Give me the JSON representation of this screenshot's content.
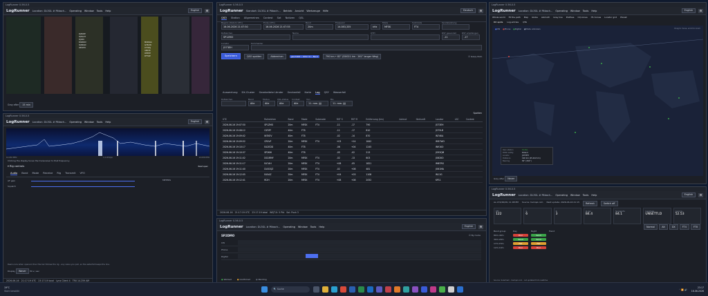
{
  "app": {
    "brand": "LogRunner",
    "title": "LogRunner 0.56.0.5",
    "lang": "English",
    "lang_de": "Deutsch"
  },
  "menus": {
    "operating": "Operating",
    "window": "Window",
    "tools": "Tools",
    "help": "Help"
  },
  "menus_de": {
    "betrieb": "Betrieb",
    "ansicht": "Ansicht",
    "werkzeuge": "Werkzeuge",
    "hilfe": "Hilfe"
  },
  "location_en": "Location: DL3GL # Pöbach...",
  "location_de": "Standort: DL3GL # Pöbach...",
  "bandmap": {
    "title": "LogRunner 0.56.0.5",
    "gray_label": "Gray after",
    "gray_value": "15 min",
    "spots": [
      "DJ3KDE",
      "SV9CVY",
      "DJ1NC",
      "EA8DDV",
      "SQ8GSC",
      "OE1EYC",
      "MI0DGG",
      "G7RUW",
      "CT7PAJ",
      "IU8LTK",
      "OH8YE",
      "DF7GE"
    ]
  },
  "waterfall": {
    "title": "LogRunner 0.56.0.5",
    "hint": "Clicking the display tunes the transceiver to that frequency.",
    "freq_left": "14.032 MHz",
    "freq_center": "1.1 kHz/px",
    "freq_right": "14.036 MHz",
    "rig_section": "Rig controls",
    "rig_right": "Rest spec",
    "rig_tabs": [
      "Audio",
      "Band",
      "Mode",
      "Receive",
      "Rig",
      "Transmit",
      "VFO"
    ],
    "rig_rows": [
      "AF gain",
      "Squelch"
    ],
    "meters_label": "METERS",
    "bottom_hint": "Read-once when opened, then the bar follows the rig - any value you pull, so the waterfall keeps the line.",
    "display_label": "Display",
    "display_value": "Waver",
    "display_extra": "30 s / sec",
    "status": [
      "2026-06-16",
      "21:17:19 UTC",
      "23:17:19 local",
      "Lynx Client 4",
      "TRX 14.259 AM"
    ]
  },
  "qso": {
    "title": "LogRunner 0.56.0.5",
    "tabs": [
      "QSO",
      "Station",
      "Allgemeines",
      "Contest",
      "Sat",
      "Notizen",
      "QSL"
    ],
    "labels": {
      "date": "Beginn (Datum UTC)",
      "end": "Ende (UTC)",
      "band": "Band",
      "freq": "Frequenz",
      "mode": "Mode",
      "submode": "Submode",
      "tx": "Sendeleistung",
      "call": "Rufzeichen",
      "name": "Name",
      "qth": "QTH",
      "rst_s": "RST gesendet",
      "rst_r": "RST empfangen",
      "loc": "Locator",
      "comment": "Kommentar"
    },
    "values": {
      "date": "16.06.2026 21:07:50",
      "end": "16.06.2026 21:07:55",
      "band": "20m",
      "freq": "14.083,335",
      "freq_unit": "kHz",
      "mode": "MFSK",
      "submode": "FT4",
      "call": "SP1ZMO",
      "rst_s": "-11",
      "rst_r": "-17",
      "loc": "JO73EH"
    },
    "buttons": {
      "save": "Speichern",
      "spot": "QSO spotten",
      "clear": "Abbrechen",
      "tag": "geschätzt • 1002 mi • Band",
      "dist": "790 km • 82° (DX021 km · 261° langer Weg)",
      "check": "Gesp./dubl."
    },
    "subtabs": [
      "Auswertung",
      "DX-Cluster",
      "Gearbeitete Länder",
      "Geckanfall",
      "Karte",
      "Log",
      "QSY",
      "Wasserfall"
    ],
    "filters": {
      "call": "Rufzeichen",
      "band": "Band",
      "mode": "Modus",
      "qsl": "QSL-status",
      "contest": "Contest",
      "from": "Von",
      "to": "Bis",
      "all": "Alle",
      "from_val": "11. mm. jjjj",
      "to_val": "11. mm. jjjj"
    },
    "spotten": "Spotten",
    "columns": [
      "UTC",
      "Rufzeichen",
      "Band",
      "Mode",
      "Submode",
      "RST S",
      "RST R",
      "Entfernung (km)",
      "Azimut",
      "Herkunft",
      "Locator",
      "LSC",
      "Contest"
    ],
    "rows": [
      [
        "2026-06-16 19:07:50",
        "SP1ZMO",
        "20m",
        "MFSK",
        "FT4",
        "-11",
        "-17",
        "790",
        "",
        "",
        "JO73EH",
        "",
        ""
      ],
      [
        "2026-06-16 19:08:12",
        "OZ5FF",
        "40m",
        "FT8",
        "",
        "-11",
        "-17",
        "810",
        "",
        "",
        "JO75LB",
        "",
        ""
      ],
      [
        "2026-06-16 19:09:02",
        "IN7KEV",
        "40m",
        "FT8",
        "",
        "-02",
        "-14",
        "870",
        "",
        "",
        "IN74KA",
        "",
        ""
      ],
      [
        "2026-06-16 19:09:52",
        "CR5VF",
        "20m",
        "MFSK",
        "FT4",
        "+03",
        "+14",
        "1842",
        "",
        "",
        "IM57WO",
        "",
        ""
      ],
      [
        "2026-06-16 19:10:17",
        "EA2EDD",
        "40m",
        "FT8",
        "",
        "-06",
        "+04",
        "1245",
        "",
        "",
        "IN91KO",
        "",
        ""
      ],
      [
        "2026-06-16 19:10:37",
        "SP2KHI",
        "40m",
        "FT8",
        "",
        "-05",
        "-02",
        "213",
        "",
        "",
        "JO93QM",
        "",
        ""
      ],
      [
        "2026-06-16 19:11:02",
        "DG1RMY",
        "20m",
        "MFSK",
        "FT4",
        "-02",
        "-13",
        "603",
        "",
        "",
        "JO62KO",
        "",
        ""
      ],
      [
        "2026-06-16 19:11:17",
        "EA7AH",
        "20m",
        "MFSK",
        "FT4",
        "+08",
        "-05",
        "1821",
        "",
        "",
        "IM67RG",
        "",
        ""
      ],
      [
        "2026-06-16 19:11:40",
        "DL5DQZ",
        "20m",
        "MFSK",
        "FT4",
        "-02",
        "+08",
        "481",
        "",
        "",
        "JO61MA",
        "",
        ""
      ],
      [
        "2026-06-16 19:12:05",
        "EA5AZ",
        "20m",
        "MFSK",
        "FT4",
        "+04",
        "+03",
        "1108",
        "",
        "",
        "IN11G",
        "",
        ""
      ],
      [
        "2026-06-16 19:12:41",
        "RI2H",
        "20m",
        "MFSK",
        "FT4",
        "+08",
        "+08",
        "2052",
        "",
        "",
        "KP11",
        "",
        ""
      ]
    ],
    "status": [
      "2026-06-16",
      "21:17:19 UTC",
      "23:17:19 lokal",
      "WSJT-X: 5 Pkt",
      "Sol: Push 3"
    ]
  },
  "alerts": {
    "title": "LogRunner 0.56.0.5",
    "call": "SP2DMO",
    "by_mode": "By mode",
    "rows": [
      "CW",
      "Phone",
      "Digital"
    ],
    "legend": [
      "Worked",
      "Confirmed",
      "Pending"
    ]
  },
  "map": {
    "title": "LogRunner 0.56.0.5",
    "tabs": [
      "Whole world",
      "Fit the path",
      "Map",
      "Globe",
      "Azimuth",
      "Grey line",
      "Prefixes",
      "CQ zones",
      "ITU zones",
      "Locator grid",
      "Planet"
    ],
    "subtabs": [
      "DX spots",
      "Log entries",
      "QTA"
    ],
    "legend": [
      "CW",
      "Phone",
      "Digital",
      "Mode unknown"
    ],
    "legend_right": "Drag to move, scroll to zoom",
    "info": [
      [
        "Own station",
        "DL3GL"
      ],
      [
        "DXCC entity",
        "Poland"
      ],
      [
        "Locator",
        "JO73EH"
      ],
      [
        "Distance",
        "190 km (25.422 km)"
      ],
      [
        "Bearing",
        "82° (262°)"
      ]
    ],
    "gray_label": "Gray after",
    "gray_value": "Never"
  },
  "prop": {
    "title": "LogRunner 0.56.0.5",
    "asof": "As of 6/26/26, 11:08 PM",
    "source": "Source: hamqsl.com",
    "next": "Next update: 2026-06-16 21:15",
    "refresh": "Refresh",
    "switch": "Switch off",
    "cards": [
      [
        "SFI",
        "122"
      ],
      [
        "A",
        "6"
      ],
      [
        "K",
        "3"
      ],
      [
        "X-ray",
        "B4.4"
      ],
      [
        "Sunspots",
        "84.1"
      ],
      [
        "Geomag",
        "UNSETTLD"
      ],
      [
        "Aurora",
        "52.53"
      ]
    ],
    "bands_header": [
      "Band group",
      "Day",
      "Night",
      "Trend"
    ],
    "bands": [
      [
        "80m-40m",
        "Poor",
        "Good"
      ],
      [
        "30m-20m",
        "Good",
        "Good"
      ],
      [
        "17m-15m",
        "Fair",
        "Fair"
      ],
      [
        "12m-10m",
        "Poor",
        "Poor"
      ]
    ],
    "modes": [
      "Normal",
      "Alt",
      "DX",
      "FT4",
      "FT8"
    ],
    "footer": "Source: Solarham · hamqsl.com · not updated from realtime"
  },
  "taskbar": {
    "weather": "19°C",
    "weather_sub": "Stark bewölkt",
    "search": "Suche",
    "time": "23:17",
    "date": "16.06.2026"
  },
  "colors": {
    "accent": "#3a5bd9",
    "poor": "#d9433a",
    "good": "#3aa648",
    "fair": "#e0a030"
  }
}
